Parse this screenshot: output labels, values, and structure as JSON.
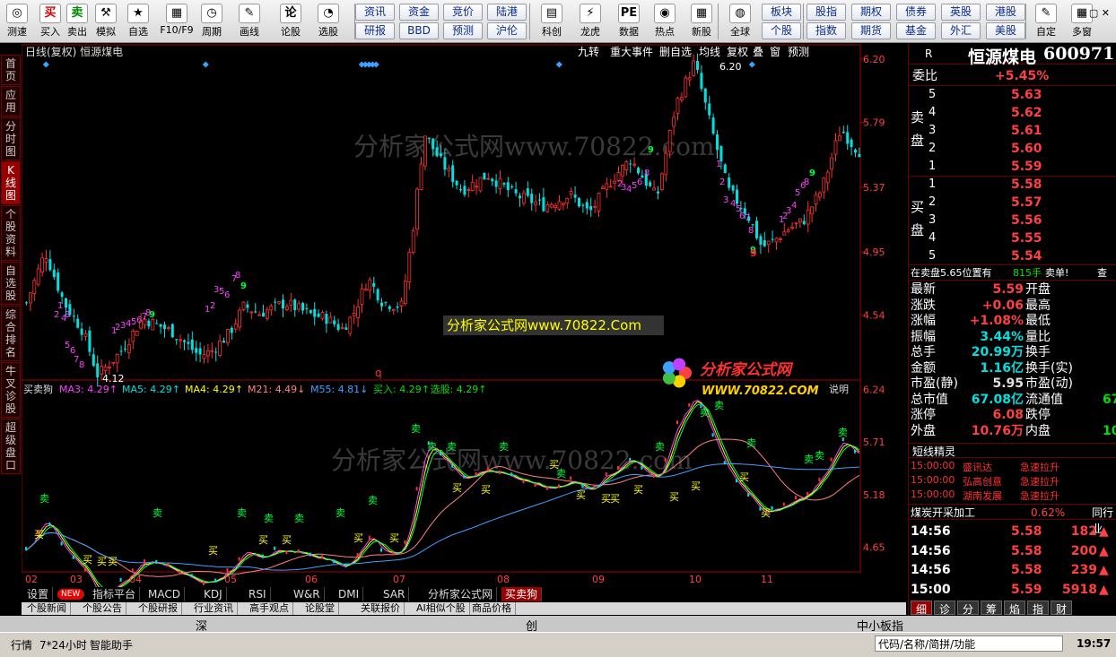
{
  "toolbar": {
    "left": [
      "测速",
      "买入",
      "卖出",
      "模拟",
      "自选",
      "F10/F9",
      "周期",
      "画线",
      "论股",
      "选股"
    ],
    "grid1": [
      "资讯",
      "资金",
      "竞价",
      "陆港"
    ],
    "grid2": [
      "研报",
      "BBD",
      "预测",
      "沪伦"
    ],
    "mid": [
      "科创",
      "龙虎",
      "数据",
      "热点",
      "新股",
      "全球"
    ],
    "grid3": [
      "板块",
      "股指",
      "期权",
      "债券",
      "英股",
      "港股"
    ],
    "grid4": [
      "个股",
      "指数",
      "期货",
      "基金",
      "外汇",
      "美股"
    ],
    "right": [
      "自定",
      "多窗"
    ],
    "icons": {
      "buy": "买",
      "sell": "卖",
      "lun": "论"
    }
  },
  "sidetabs": [
    [
      "首",
      "页"
    ],
    [
      "应",
      "用"
    ],
    [
      "分",
      "时",
      "图"
    ],
    [
      "K",
      "线",
      "图"
    ],
    [
      "个",
      "股",
      "资",
      "料"
    ],
    [
      "自",
      "选",
      "股"
    ],
    [
      "综",
      "合",
      "排",
      "名"
    ],
    [
      "牛",
      "叉",
      "诊",
      "股"
    ],
    [
      "超",
      "级",
      "盘",
      "口"
    ]
  ],
  "chart": {
    "title": "日线(复权) 恒源煤电",
    "menu": [
      "九转",
      "重大事件",
      "删自选",
      "均线",
      "复权",
      "叠",
      "窗",
      "预测"
    ],
    "price_axis": [
      "6.20",
      "5.79",
      "5.37",
      "4.95",
      "4.54"
    ],
    "ind_axis": [
      "6.24",
      "5.71",
      "5.18",
      "4.65"
    ],
    "months": [
      "02",
      "03",
      "04",
      "05",
      "06",
      "07",
      "08",
      "09",
      "10",
      "11"
    ],
    "high_label": "6.20",
    "low_label": "4.12",
    "indicator_name": "买卖狗",
    "indicator": [
      {
        "t": "MA3: 4.29↑",
        "c": "#ff40ff"
      },
      {
        "t": "MA5: 4.29↑",
        "c": "#00e0e0"
      },
      {
        "t": "MA4: 4.29↑",
        "c": "#ffff00"
      },
      {
        "t": "M21: 4.49↓",
        "c": "#ff8080"
      },
      {
        "t": "M55: 4.81↓",
        "c": "#40a0ff"
      },
      {
        "t": "买入: 4.29↑",
        "c": "#00e000"
      },
      {
        "t": "选股: 4.29↑",
        "c": "#00e000"
      }
    ],
    "explain": "说明",
    "watermark1": "分析家公式网www.70822.com",
    "watermark2": "分析家公式网www.70822.Com",
    "watermark3": "分析家公式网www.70822.com",
    "logo_name": "分析家公式网",
    "logo_url": "WWW.70822.COM",
    "buy": "买",
    "sell": "卖"
  },
  "chart_data": {
    "type": "candlestick",
    "x": [
      "02",
      "03",
      "04",
      "05",
      "06",
      "07",
      "08",
      "09",
      "10",
      "11"
    ],
    "close_per_month": [
      4.78,
      4.25,
      4.45,
      4.62,
      4.62,
      5.57,
      5.42,
      5.35,
      5.55,
      5.59
    ],
    "ylim": [
      4.12,
      6.2
    ]
  },
  "right": {
    "title": "恒源煤电",
    "code": "600971",
    "r": "R",
    "weibi_label": "委比",
    "weibi": "+5.45%",
    "sell_label": [
      "卖",
      "盘"
    ],
    "buy_label": [
      "买",
      "盘"
    ],
    "sell": [
      [
        "5",
        "5.63"
      ],
      [
        "4",
        "5.62"
      ],
      [
        "3",
        "5.61"
      ],
      [
        "2",
        "5.60"
      ],
      [
        "1",
        "5.59"
      ]
    ],
    "buy": [
      [
        "1",
        "5.58"
      ],
      [
        "2",
        "5.57"
      ],
      [
        "3",
        "5.56"
      ],
      [
        "4",
        "5.55"
      ],
      [
        "5",
        "5.54"
      ]
    ],
    "note": "在卖盘5.65位置有",
    "note_vol": "815手",
    "note_tail": "卖单!",
    "note_look": "查",
    "stats": [
      [
        "最新",
        "5.59",
        "开盘",
        ""
      ],
      [
        "涨跌",
        "+0.06",
        "最高",
        ""
      ],
      [
        "涨幅",
        "+1.08%",
        "最低",
        ""
      ],
      [
        "振幅",
        "3.44%",
        "量比",
        ""
      ],
      [
        "总手",
        "20.99万",
        "换手",
        ""
      ],
      [
        "金额",
        "1.16亿",
        "换手(实)",
        ""
      ],
      [
        "市盈(静)",
        "5.95",
        "市盈(动)",
        ""
      ],
      [
        "总市值",
        "67.08亿",
        "流通值",
        "67"
      ],
      [
        "涨停",
        "6.08",
        "跌停",
        ""
      ],
      [
        "外盘",
        "10.76万",
        "内盘",
        "10"
      ]
    ],
    "jl_title": "短线精灵",
    "jl": [
      [
        "15:00:00",
        "盛讯达",
        "急速拉升"
      ],
      [
        "15:00:00",
        "弘高创意",
        "急速拉升"
      ],
      [
        "15:00:00",
        "湖南发展",
        "急速拉升"
      ]
    ],
    "sector": "煤炭开采加工",
    "sector_pct": "0.62%",
    "sector_link": "同行业",
    "ticks": [
      [
        "14:56",
        "5.58",
        "182"
      ],
      [
        "14:56",
        "5.58",
        "200"
      ],
      [
        "14:56",
        "5.58",
        "239"
      ],
      [
        "15:00",
        "5.59",
        "5918"
      ]
    ],
    "bottom_tabs": [
      "细",
      "诊",
      "分",
      "筹",
      "焰",
      "指",
      "财"
    ]
  },
  "bottom_tabs": [
    "设置",
    "NEW",
    "指标平台",
    "MACD",
    "KDJ",
    "RSI",
    "W&R",
    "DMI",
    "SAR",
    "分析家公式网",
    "买卖狗"
  ],
  "news_tabs": [
    "个股新闻",
    "个股公告",
    "个股研报",
    "行业资讯",
    "高手观点",
    "论股堂",
    "关联报价",
    "AI相似个股",
    "商品价格"
  ],
  "market": [
    "深",
    "创",
    "中小板指"
  ],
  "status": {
    "hangqing": "行情",
    "h24": "7*24小时",
    "zhushou": "智能助手",
    "search": "代码/名称/简拼/功能",
    "time": "19:57"
  }
}
